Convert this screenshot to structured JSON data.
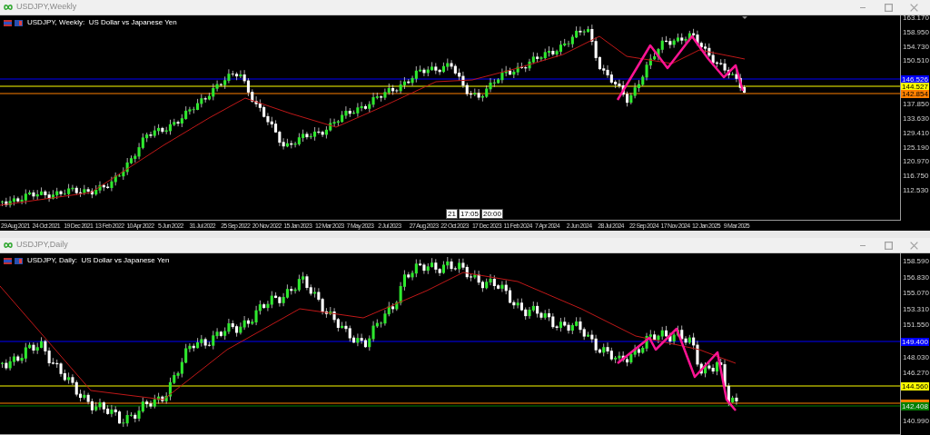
{
  "windows": [
    {
      "title": "USDJPY,Weekly",
      "header": "USDJPY, Weekly:  US Dollar vs Japanese Yen",
      "price_labels": [
        "163.170",
        "158.950",
        "154.730",
        "150.510",
        "137.850",
        "133.630",
        "129.410",
        "125.190",
        "120.970",
        "116.750",
        "112.530"
      ],
      "levels": [
        {
          "label": "146.526",
          "color": "#0000ff"
        },
        {
          "label": "144.527",
          "color": "#ffff00"
        },
        {
          "label": "142.854",
          "color": "#ff8000"
        }
      ],
      "time_labels": [
        "29 Aug 2021",
        "24 Oct 2021",
        "19 Dec 2021",
        "13 Feb 2022",
        "10 Apr 2022",
        "5 Jun 2022",
        "31 Jul 2022",
        "25 Sep 2022",
        "20 Nov 2022",
        "15 Jan 2023",
        "12 Mar 2023",
        "7 May 2023",
        "2 Jul 2023",
        "27 Aug 2023",
        "22 Oct 2023",
        "17 Dec 2023",
        "11 Feb 2024",
        "7 Apr 2024",
        "2 Jun 2024",
        "28 Jul 2024",
        "22 Sep 2024",
        "17 Nov 2024",
        "12 Jan 2025",
        "9 Mar 2025"
      ],
      "crosshair_labels": [
        "21",
        "17:05",
        "20:00"
      ]
    },
    {
      "title": "USDJPY,Daily",
      "header": "USDJPY, Daily:  US Dollar vs Japanese Yen",
      "price_labels": [
        "158.590",
        "156.830",
        "155.070",
        "153.310",
        "151.550",
        "148.030",
        "146.270",
        "140.990"
      ],
      "levels": [
        {
          "label": "149.400",
          "color": "#0000ff"
        },
        {
          "label": "144.560",
          "color": "#ffff00"
        },
        {
          "color": "#ff8000"
        },
        {
          "label": "142.408",
          "color": "#008000"
        }
      ]
    }
  ]
}
